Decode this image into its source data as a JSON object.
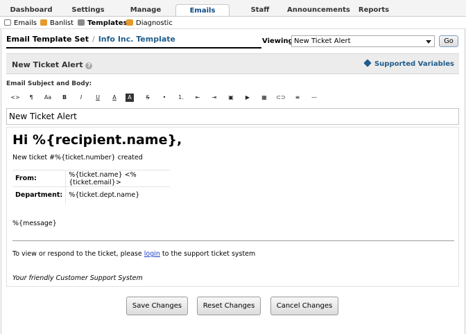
{
  "nav": {
    "tabs": [
      "Dashboard",
      "Settings",
      "Manage",
      "Emails",
      "Staff",
      "Announcements",
      "Reports"
    ],
    "active": "Emails"
  },
  "subnav": {
    "items": [
      "Emails",
      "Banlist",
      "Templates",
      "Diagnostic"
    ],
    "active": "Templates"
  },
  "header": {
    "title": "Email Template Set",
    "separator": "/",
    "template_name": "Info Inc. Template",
    "viewing_label": "Viewing:",
    "viewing_value": "New Ticket Alert",
    "go_label": "Go"
  },
  "section": {
    "title": "New Ticket Alert",
    "help_icon": "question-mark",
    "supported_label": "Supported Variables"
  },
  "editor": {
    "subject_label": "Email Subject and Body:",
    "toolbar": [
      "<>",
      "¶",
      "Aa",
      "B",
      "I",
      "U",
      "A",
      "A",
      "S",
      "•",
      "1.",
      "⇤",
      "⇥",
      "▣",
      "▶",
      "▦",
      "⊂⊃",
      "≡",
      "—"
    ],
    "subject_value": "New Ticket Alert",
    "body": {
      "greeting": "Hi %{recipient.name},",
      "line1": "New ticket #%{ticket.number} created",
      "table": [
        {
          "key": "From:",
          "value": "%{ticket.name} <%{ticket.email}>"
        },
        {
          "key": "Department:",
          "value": "%{ticket.dept.name}"
        }
      ],
      "message": "%{message}",
      "respond_prefix": "To view or respond to the ticket, please",
      "respond_link": "login",
      "respond_suffix": "to the support ticket system",
      "signoff": "Your friendly Customer Support System"
    }
  },
  "buttons": {
    "save": "Save Changes",
    "reset": "Reset Changes",
    "cancel": "Cancel Changes"
  },
  "colors": {
    "link": "#1f5c8b",
    "active_tab": "#0b4a85"
  }
}
